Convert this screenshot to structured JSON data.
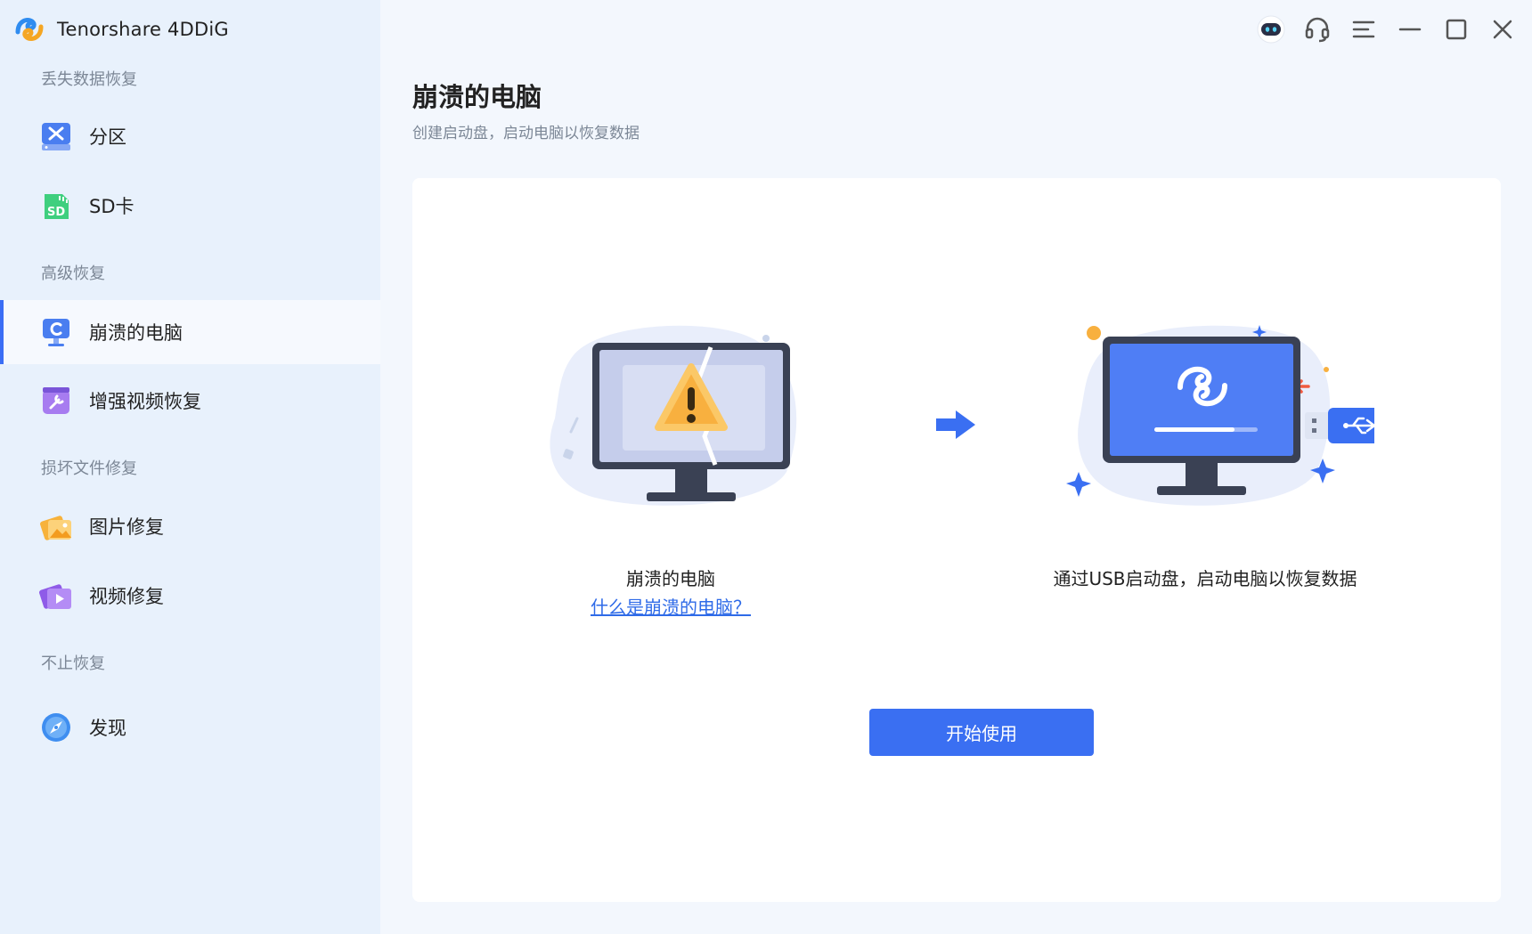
{
  "app": {
    "title": "Tenorshare 4DDiG",
    "brand_color": "#3b6ef5"
  },
  "sidebar": {
    "sections": [
      {
        "label": "丢失数据恢复"
      },
      {
        "label": "高级恢复"
      },
      {
        "label": "损坏文件修复"
      },
      {
        "label": "不止恢复"
      }
    ],
    "items": [
      {
        "label": "分区",
        "icon": "partition-icon"
      },
      {
        "label": "SD卡",
        "icon": "sd-card-icon"
      },
      {
        "label": "崩溃的电脑",
        "icon": "crashed-computer-icon",
        "active": true
      },
      {
        "label": "增强视频恢复",
        "icon": "video-enhance-icon"
      },
      {
        "label": "图片修复",
        "icon": "photo-repair-icon"
      },
      {
        "label": "视频修复",
        "icon": "video-repair-icon"
      },
      {
        "label": "发现",
        "icon": "compass-icon"
      }
    ]
  },
  "titlebar": {
    "icons": [
      "assistant-robot-icon",
      "headset-icon",
      "menu-icon",
      "minimize-icon",
      "maximize-icon",
      "close-icon"
    ]
  },
  "main": {
    "title": "崩溃的电脑",
    "subtitle": "创建启动盘，启动电脑以恢复数据",
    "left_caption": "崩溃的电脑",
    "left_link": "什么是崩溃的电脑？",
    "right_caption": "通过USB启动盘，启动电脑以恢复数据",
    "start_button": "开始使用"
  }
}
